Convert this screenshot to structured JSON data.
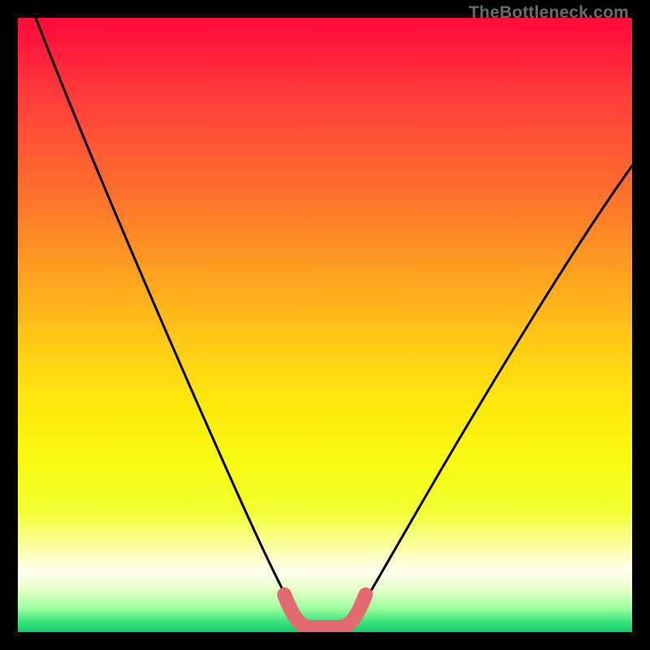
{
  "watermark": {
    "text": "TheBottleneck.com"
  },
  "chart_data": {
    "type": "line",
    "title": "",
    "xlabel": "",
    "ylabel": "",
    "xlim": [
      0,
      100
    ],
    "ylim": [
      0,
      100
    ],
    "series": [
      {
        "name": "bottleneck-curve",
        "x": [
          3,
          7,
          12,
          18,
          24,
          29,
          33,
          37,
          40,
          43,
          46,
          48,
          52,
          55,
          59,
          64,
          70,
          76,
          83,
          91,
          100
        ],
        "values": [
          100,
          90,
          79,
          66,
          53,
          41,
          31,
          22,
          14,
          8,
          3,
          0,
          0,
          3,
          9,
          17,
          26,
          35,
          44,
          54,
          64
        ]
      }
    ],
    "annotations": [
      {
        "name": "sweet-spot-marker",
        "x_range": [
          43,
          55
        ],
        "color": "#e46a72"
      }
    ],
    "background": "vertical-gradient-red-to-green"
  }
}
